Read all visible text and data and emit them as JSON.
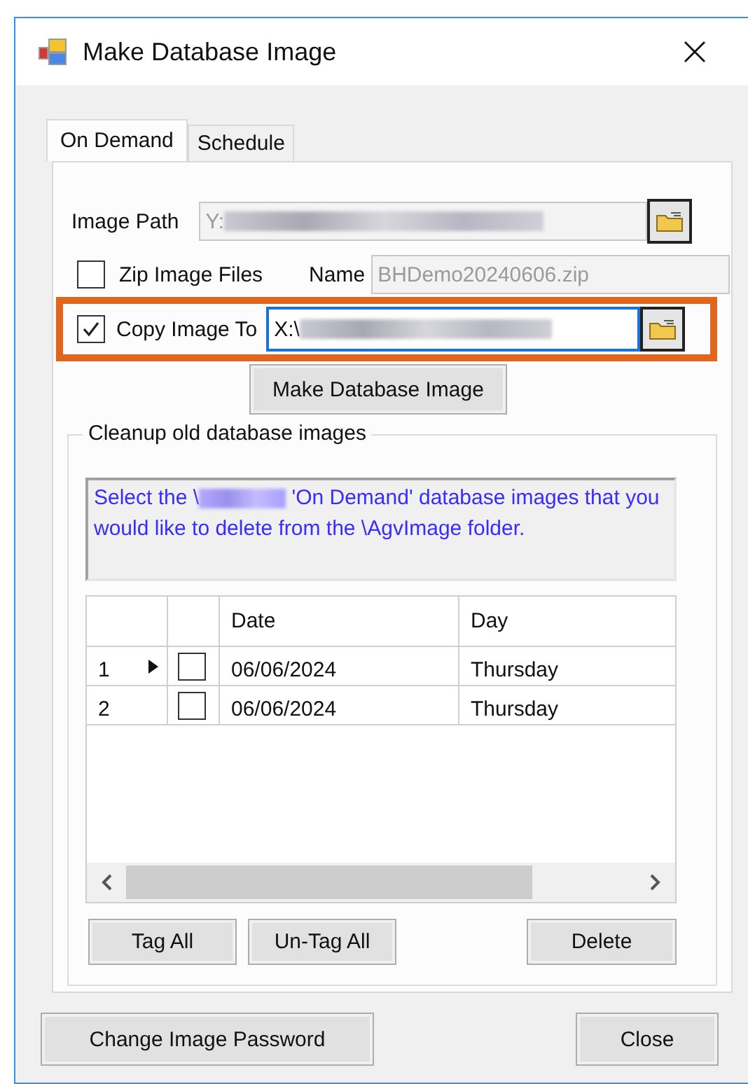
{
  "window": {
    "title": "Make Database Image"
  },
  "tabs": [
    {
      "label": "On Demand",
      "selected": true
    },
    {
      "label": "Schedule",
      "selected": false
    }
  ],
  "image_path": {
    "label": "Image Path",
    "value": "Y:",
    "disabled": true
  },
  "zip_files": {
    "label": "Zip Image Files",
    "checked": false
  },
  "name": {
    "label": "Name",
    "value": "BHDemo20240606.zip",
    "disabled": true
  },
  "copy_image_to": {
    "label": "Copy Image To",
    "checked": true,
    "value": "X:\\",
    "highlighted": true
  },
  "make_button": "Make Database Image",
  "cleanup": {
    "title": "Cleanup old database images",
    "description_start": "Select the \\",
    "description_end": "'On Demand' database images that you would like to delete from the \\AgvImage folder.",
    "table": {
      "columns": [
        "Date",
        "Day"
      ],
      "rows": [
        {
          "number": "1",
          "current": true,
          "checked": false,
          "date": "06/06/2024",
          "day": "Thursday"
        },
        {
          "number": "2",
          "current": false,
          "checked": false,
          "date": "06/06/2024",
          "day": "Thursday"
        }
      ]
    },
    "buttons": [
      "Tag All",
      "Un-Tag All",
      "Delete"
    ]
  },
  "footer_buttons": [
    "Change Image Password",
    "Close"
  ]
}
